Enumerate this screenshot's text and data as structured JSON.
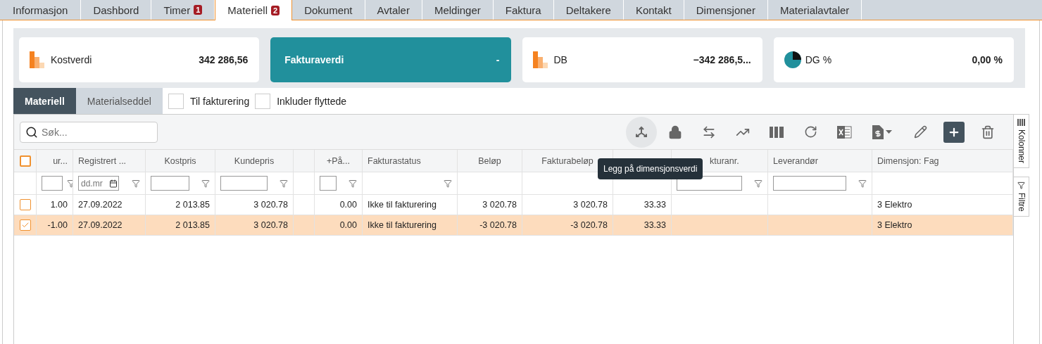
{
  "tabs": [
    {
      "label": "Informasjon",
      "selected": false
    },
    {
      "label": "Dashbord",
      "selected": false
    },
    {
      "label": "Timer",
      "selected": false,
      "badge": "1"
    },
    {
      "label": "Materiell",
      "selected": true,
      "badge": "2"
    },
    {
      "label": "Dokument",
      "selected": false
    },
    {
      "label": "Avtaler",
      "selected": false
    },
    {
      "label": "Meldinger",
      "selected": false
    },
    {
      "label": "Faktura",
      "selected": false
    },
    {
      "label": "Deltakere",
      "selected": false
    },
    {
      "label": "Kontakt",
      "selected": false
    },
    {
      "label": "Dimensjoner",
      "selected": false
    },
    {
      "label": "Materialavtaler",
      "selected": false
    }
  ],
  "kpis": [
    {
      "label": "Kostverdi",
      "value": "342 286,56",
      "selected": false,
      "kind": "bars"
    },
    {
      "label": "Fakturaverdi",
      "value": "-",
      "selected": true,
      "kind": "plain"
    },
    {
      "label": "DB",
      "value": "−342 286,5...",
      "selected": false,
      "kind": "bars"
    },
    {
      "label": "DG %",
      "value": "0,00 %",
      "selected": false,
      "kind": "pie"
    }
  ],
  "subtabs": [
    {
      "label": "Materiell",
      "selected": true
    },
    {
      "label": "Materialseddel",
      "selected": false
    }
  ],
  "toggles": [
    {
      "label": "Til fakturering",
      "checked": false
    },
    {
      "label": "Inkluder flyttede",
      "checked": false
    }
  ],
  "search": {
    "placeholder": "Søk..."
  },
  "toolbar": [
    {
      "kind": "dimension",
      "hovered": true
    },
    {
      "kind": "lock",
      "hovered": false
    },
    {
      "kind": "swap",
      "hovered": false
    },
    {
      "kind": "trend",
      "hovered": false
    },
    {
      "kind": "columns",
      "hovered": false
    },
    {
      "kind": "refresh",
      "hovered": false
    },
    {
      "kind": "excel",
      "hovered": false
    },
    {
      "kind": "invoice",
      "hovered": false
    },
    {
      "kind": "edit",
      "hovered": false
    },
    {
      "kind": "add",
      "hovered": false
    },
    {
      "kind": "delete",
      "hovered": false
    }
  ],
  "tooltip": {
    "text": "Legg på dimensjonsverdi"
  },
  "table": {
    "header_checkbox": {
      "checked": false
    },
    "columns": [
      {
        "label": "ur...",
        "kind": "input"
      },
      {
        "label": "Registrert ...",
        "kind": "date",
        "filter_value": "dd.mr"
      },
      {
        "label": "Kostpris",
        "kind": "input"
      },
      {
        "label": "Kundepris",
        "kind": "input"
      },
      {
        "kind": "none"
      },
      {
        "label": "+På...",
        "kind": "input"
      },
      {
        "label": "Fakturastatus",
        "kind": "funnel"
      },
      {
        "label": "Beløp",
        "kind": "none"
      },
      {
        "label": "Fakturabeløp",
        "kind": "none"
      },
      {
        "kind": "none"
      },
      {
        "label": "kturanr.",
        "kind": "input"
      },
      {
        "label": "Leverandør",
        "kind": "input"
      },
      {
        "label": "Dimensjon: Fag",
        "kind": "none"
      }
    ],
    "rows": [
      {
        "selected": false,
        "checked": false,
        "cells": [
          "1.00",
          "27.09.2022",
          "2 013.85",
          "3 020.78",
          null,
          "0.00",
          "Ikke til fakturering",
          "3 020.78",
          "3 020.78",
          "33.33",
          null,
          null,
          "3 Elektro"
        ]
      },
      {
        "selected": true,
        "checked": true,
        "cells": [
          "-1.00",
          "27.09.2022",
          "2 013.85",
          "3 020.78",
          null,
          "0.00",
          "Ikke til fakturering",
          "-3 020.78",
          "-3 020.78",
          "33.33",
          null,
          null,
          "3 Elektro"
        ]
      }
    ]
  },
  "side_tabs": [
    {
      "label": "Kolonner",
      "kind": "columns"
    },
    {
      "label": "Filtre",
      "kind": "filter"
    }
  ]
}
